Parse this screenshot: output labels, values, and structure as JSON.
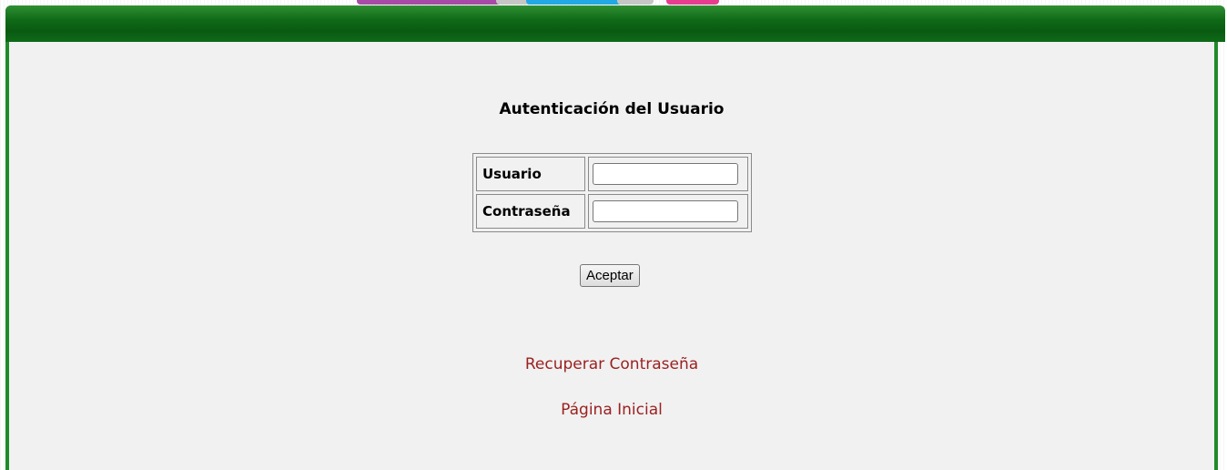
{
  "colors": {
    "header_green": "#0f6a17",
    "frame_green": "#1f8a2a",
    "content_bg": "#f1f1f1",
    "link_red": "#9b2121",
    "tab_purple": "#a84aa8",
    "tab_gray": "#c6c6c6",
    "tab_blue": "#22a8e4",
    "tab_pink": "#e83c91"
  },
  "login": {
    "title": "Autenticación del Usuario",
    "user_label": "Usuario",
    "user_value": "",
    "password_label": "Contraseña",
    "password_value": "",
    "submit_label": "Aceptar"
  },
  "links": {
    "recover_password": "Recuperar Contraseña",
    "home_page": "Página Inicial"
  }
}
